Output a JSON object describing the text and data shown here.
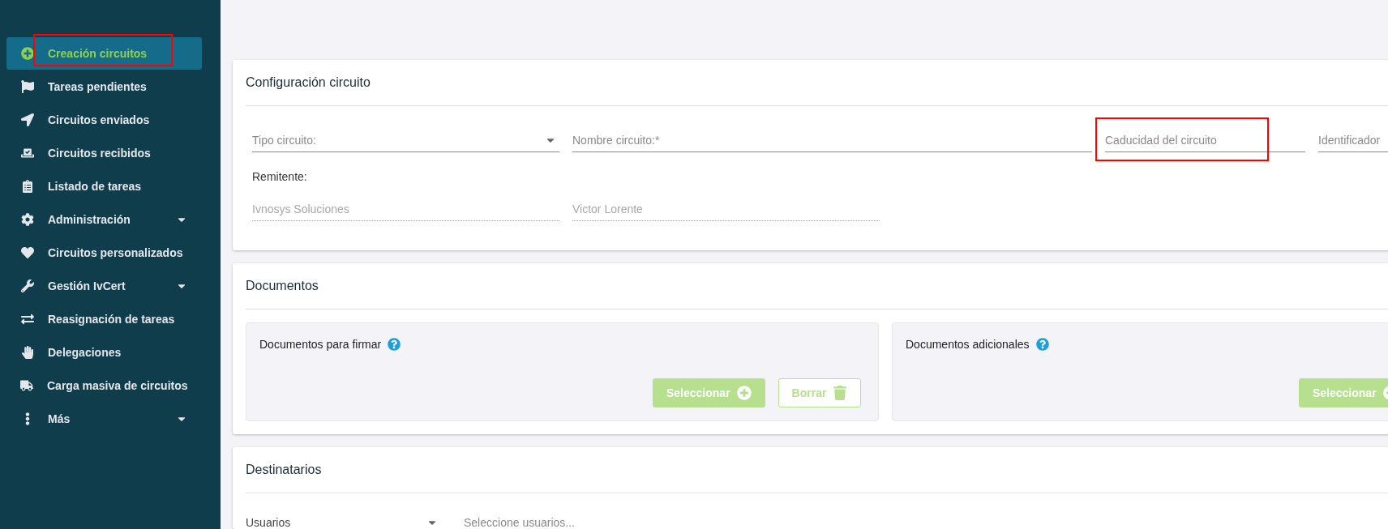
{
  "sidebar": {
    "items": [
      {
        "label": "Creación circuitos",
        "selected": true,
        "has_submenu": false,
        "highlighted": true
      },
      {
        "label": "Tareas pendientes",
        "selected": false,
        "has_submenu": false,
        "highlighted": false
      },
      {
        "label": "Circuitos enviados",
        "selected": false,
        "has_submenu": false,
        "highlighted": false
      },
      {
        "label": "Circuitos recibidos",
        "selected": false,
        "has_submenu": false,
        "highlighted": false
      },
      {
        "label": "Listado de tareas",
        "selected": false,
        "has_submenu": false,
        "highlighted": false
      },
      {
        "label": "Administración",
        "selected": false,
        "has_submenu": true,
        "highlighted": false
      },
      {
        "label": "Circuitos personalizados",
        "selected": false,
        "has_submenu": false,
        "highlighted": false
      },
      {
        "label": "Gestión IvCert",
        "selected": false,
        "has_submenu": true,
        "highlighted": false
      },
      {
        "label": "Reasignación de tareas",
        "selected": false,
        "has_submenu": false,
        "highlighted": false
      },
      {
        "label": "Delegaciones",
        "selected": false,
        "has_submenu": false,
        "highlighted": false
      },
      {
        "label": "Carga masiva de circuitos",
        "selected": false,
        "has_submenu": false,
        "highlighted": false
      },
      {
        "label": "Más",
        "selected": false,
        "has_submenu": true,
        "highlighted": false
      }
    ]
  },
  "configuracion": {
    "title": "Configuración circuito",
    "fields": [
      {
        "kind": "select",
        "placeholder": "Tipo circuito:",
        "highlighted": false
      },
      {
        "kind": "text",
        "placeholder": "Nombre circuito:*",
        "highlighted": false
      },
      {
        "kind": "text",
        "placeholder": "Caducidad del circuito",
        "highlighted": true
      },
      {
        "kind": "text",
        "placeholder": "Identificador",
        "highlighted": false
      }
    ],
    "remitente_label": "Remitente:",
    "remitente_fields": [
      {
        "value": "Ivnosys Soluciones",
        "disabled": true
      },
      {
        "value": "Victor  Lorente",
        "disabled": true
      }
    ]
  },
  "documentos": {
    "title": "Documentos",
    "panels": [
      {
        "title": "Documentos para firmar",
        "buttons": [
          {
            "kind": "select",
            "label": "Seleccionar"
          },
          {
            "kind": "delete",
            "label": "Borrar"
          }
        ]
      },
      {
        "title": "Documentos adicionales",
        "buttons": [
          {
            "kind": "select",
            "label": "Seleccionar"
          }
        ]
      }
    ]
  },
  "destinatarios": {
    "title": "Destinatarios",
    "select": {
      "value": "Usuarios"
    },
    "users_field": {
      "placeholder": "Seleccione usuarios..."
    }
  }
}
